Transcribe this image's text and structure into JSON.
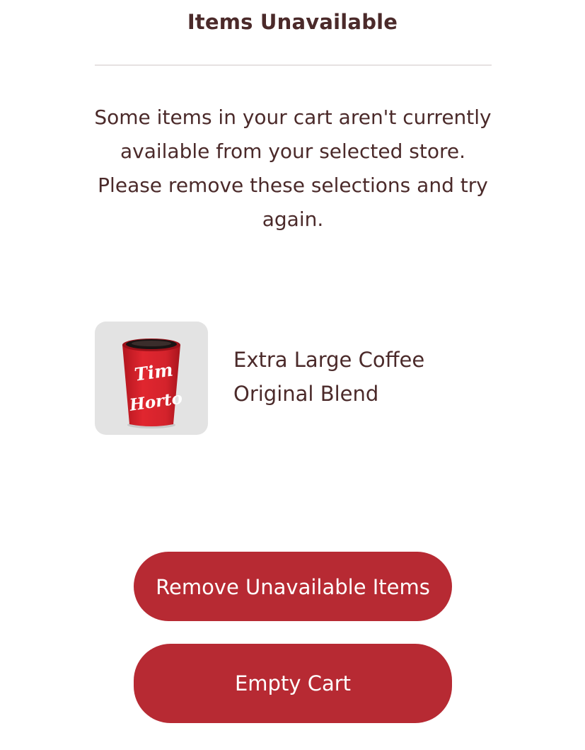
{
  "dialog": {
    "title": "Items Unavailable",
    "message": "Some items in your cart aren't currently available from your selected store. Please remove these selections and try again."
  },
  "unavailable_items": [
    {
      "name_line1": "Extra Large Coffee",
      "name_line2": "Original Blend",
      "image": "tim-hortons-coffee-cup-image",
      "cup_logo_text": "Tim Hortons"
    }
  ],
  "actions": {
    "remove_label": "Remove Unavailable Items",
    "empty_label": "Empty Cart"
  },
  "colors": {
    "text": "#4b2a2a",
    "button_bg": "#b72a33",
    "button_text": "#ffffff",
    "thumb_bg": "#e3e3e3",
    "cup_red": "#d4232c"
  }
}
